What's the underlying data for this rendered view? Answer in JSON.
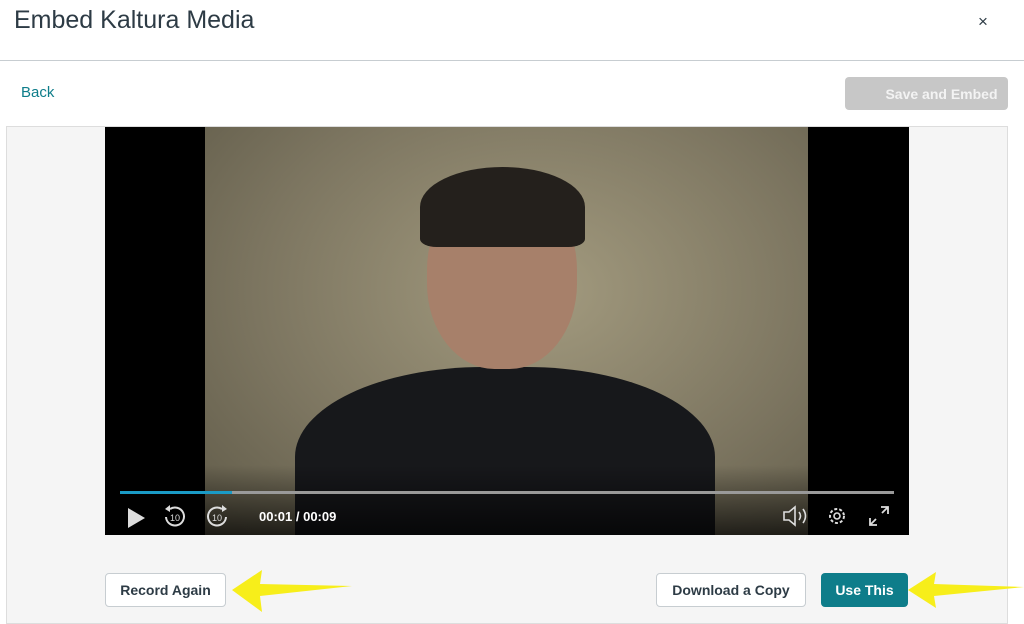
{
  "header": {
    "title": "Embed Kaltura Media",
    "close_icon": "×"
  },
  "toolbar": {
    "back_label": "Back",
    "save_label": "Save and Embed"
  },
  "player": {
    "current_time": "00:01",
    "duration": "00:09",
    "time_display": "00:01 / 00:09",
    "progress_percent": 14.5,
    "progress_color": "#1a9bc6",
    "rewind_label": "10",
    "forward_label": "10"
  },
  "actions": {
    "record_again": "Record Again",
    "download": "Download a Copy",
    "use_this": "Use This",
    "accent": "#0e7d8a"
  }
}
